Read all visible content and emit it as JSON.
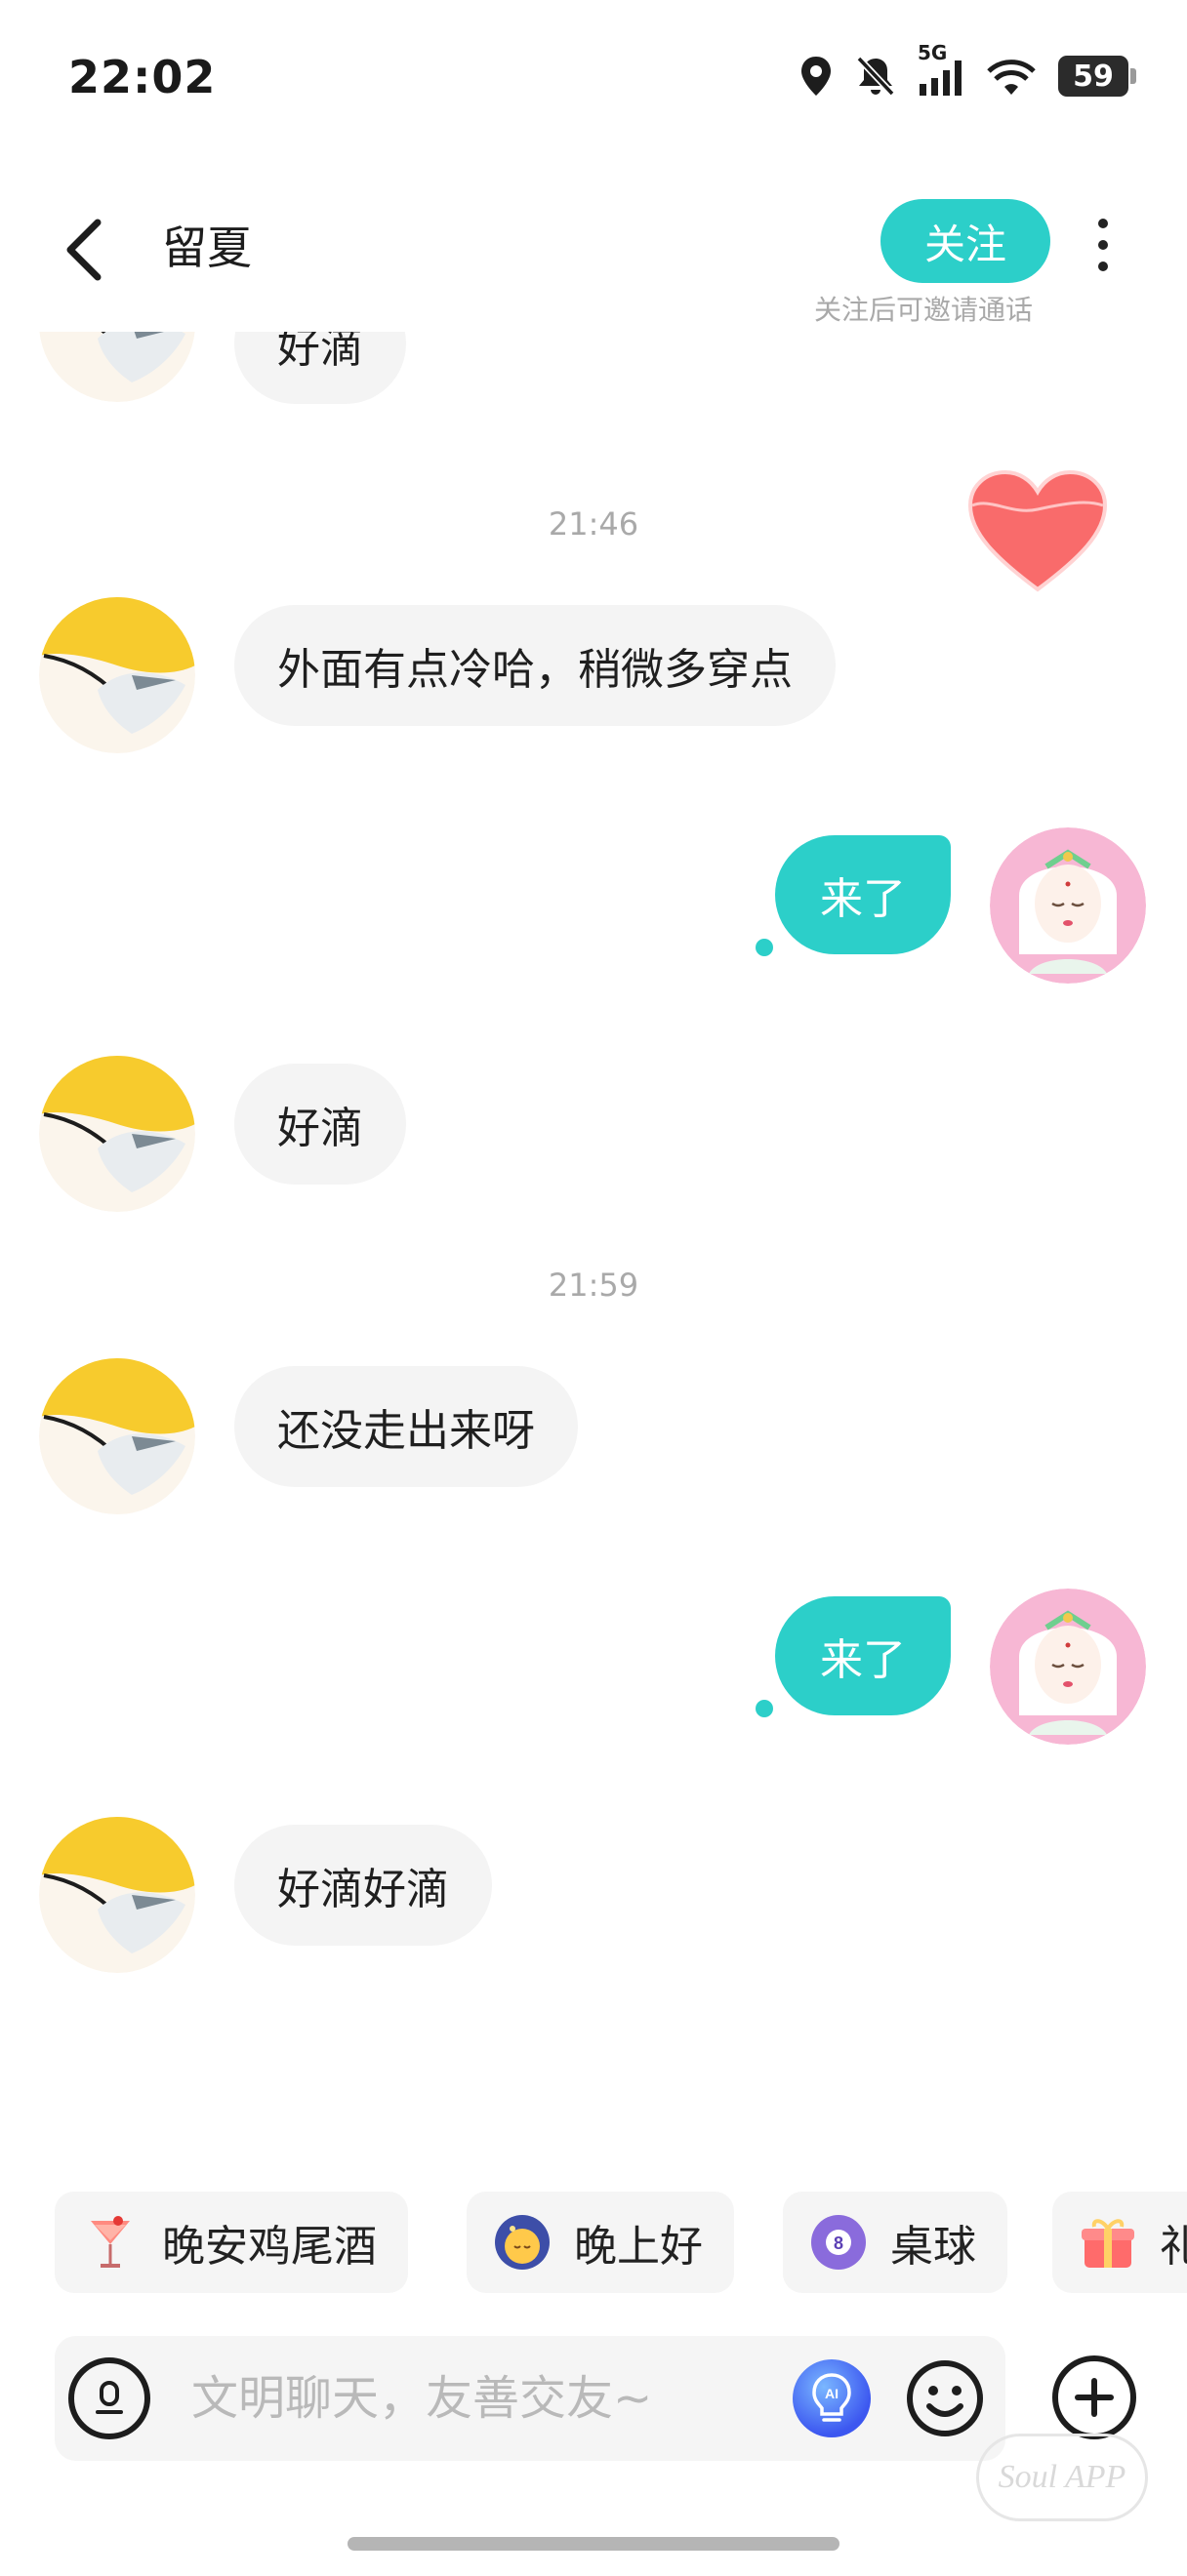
{
  "status_bar": {
    "time": "22:02",
    "network": "5G",
    "battery": "59",
    "icons": [
      "location-icon",
      "bell-muted-icon",
      "signal-icon",
      "wifi-icon",
      "battery-icon"
    ]
  },
  "header": {
    "title": "留夏",
    "follow_label": "关注",
    "follow_hint": "关注后可邀请通话"
  },
  "messages": [
    {
      "side": "left",
      "text": "好滴"
    },
    {
      "type": "timestamp",
      "text": "21:46"
    },
    {
      "side": "left",
      "text": "外面有点冷哈，稍微多穿点"
    },
    {
      "side": "right",
      "text": "来了"
    },
    {
      "side": "left",
      "text": "好滴"
    },
    {
      "type": "timestamp",
      "text": "21:59"
    },
    {
      "side": "left",
      "text": "还没走出来呀"
    },
    {
      "side": "right",
      "text": "来了"
    },
    {
      "side": "left",
      "text": "好滴好滴"
    }
  ],
  "quick_replies": [
    {
      "label": "晚安鸡尾酒",
      "icon": "cocktail-icon"
    },
    {
      "label": "晚上好",
      "icon": "moon-face-icon"
    },
    {
      "label": "桌球",
      "icon": "billiard-ball-icon"
    },
    {
      "label": "礼",
      "icon": "gift-icon"
    }
  ],
  "input": {
    "placeholder": "文明聊天，友善交友~",
    "value": ""
  },
  "watermark": "Soul APP",
  "colors": {
    "accent": "#2ccfc9",
    "bubble_left": "#f4f4f4",
    "heart": "#f96b6b"
  }
}
